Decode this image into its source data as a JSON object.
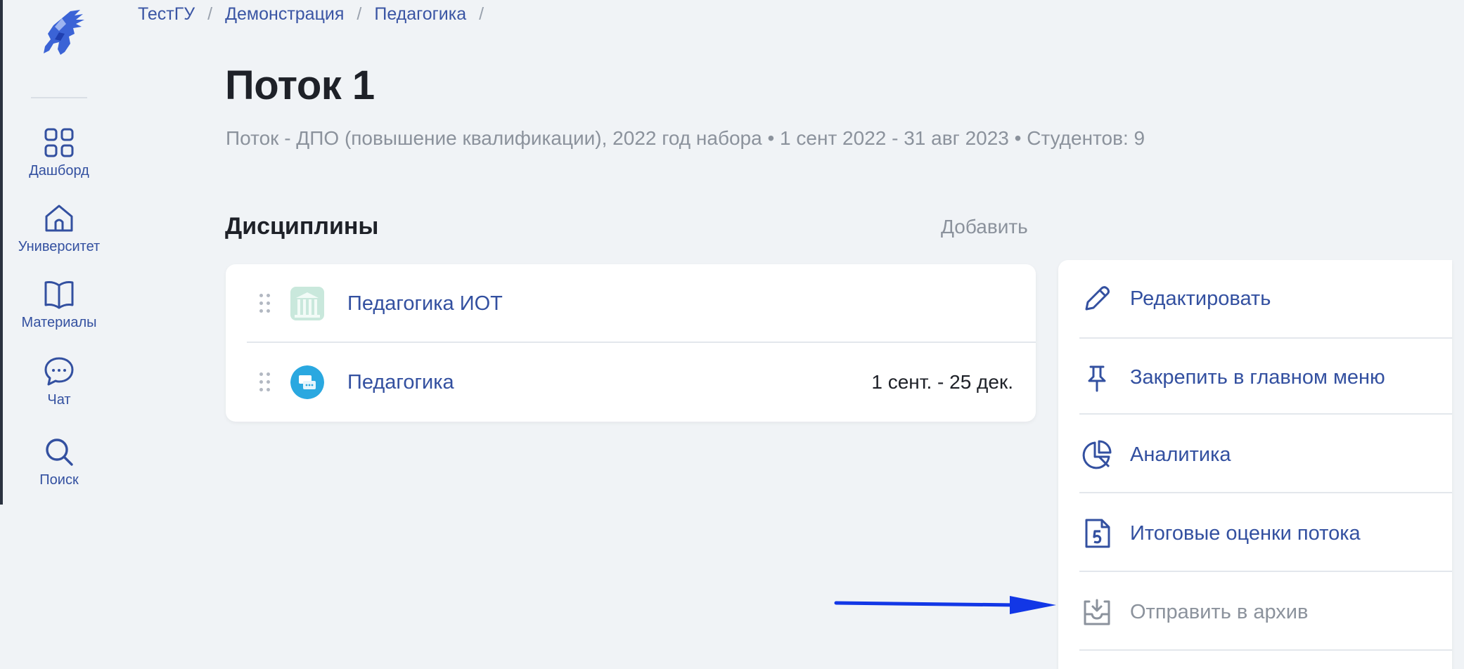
{
  "colors": {
    "accent": "#3350a0",
    "muted": "#8b929c",
    "title": "#1e2128",
    "background": "#f0f3f6",
    "annotation_arrow": "#1237e6"
  },
  "breadcrumb": [
    {
      "label": "ТестГУ"
    },
    {
      "label": "Демонстрация"
    },
    {
      "label": "Педагогика"
    }
  ],
  "breadcrumb_separator": "/",
  "sidebar": {
    "logo_icon": "warrior-head-logo",
    "items": [
      {
        "label": "Дашборд",
        "icon": "grid-icon"
      },
      {
        "label": "Университет",
        "icon": "home-icon"
      },
      {
        "label": "Материалы",
        "icon": "book-icon"
      },
      {
        "label": "Чат",
        "icon": "chat-icon"
      },
      {
        "label": "Поиск",
        "icon": "search-icon"
      }
    ]
  },
  "header": {
    "title": "Поток 1",
    "subtitle": "Поток - ДПО (повышение квалификации), 2022 год набора • 1 сент 2022 - 31 авг 2023 • Студентов: 9"
  },
  "disciplines": {
    "title": "Дисциплины",
    "add_label": "Добавить",
    "items": [
      {
        "name": "Педагогика ИОТ",
        "dates": "",
        "thumb": "building-thumbnail"
      },
      {
        "name": "Педагогика",
        "dates": "1 сент. - 25 дек.",
        "thumb": "chat-bubble-thumbnail"
      }
    ]
  },
  "actions": [
    {
      "label": "Редактировать",
      "icon": "pencil-icon",
      "enabled": true
    },
    {
      "label": "Закрепить в главном меню",
      "icon": "pin-icon",
      "enabled": true
    },
    {
      "label": "Аналитика",
      "icon": "pie-chart-icon",
      "enabled": true
    },
    {
      "label": "Итоговые оценки потока",
      "icon": "grade-document-icon",
      "enabled": true
    },
    {
      "label": "Отправить в архив",
      "icon": "archive-icon",
      "enabled": false
    }
  ]
}
